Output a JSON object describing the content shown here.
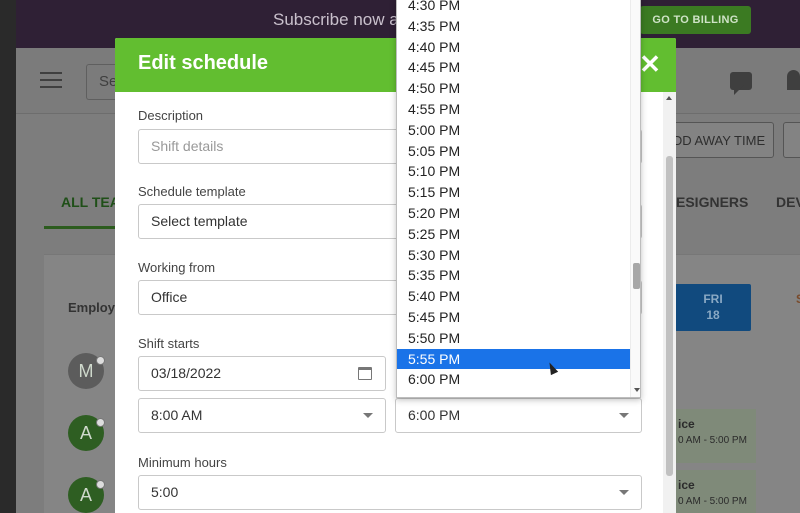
{
  "banner": {
    "subscribe_text": "Subscribe now a",
    "billing_button": "GO TO BILLING"
  },
  "appbar": {
    "search_placeholder": "Se",
    "add_away_button": "DD AWAY TIME"
  },
  "tabs": {
    "all": "ALL TEA",
    "designers": "ESIGNERS",
    "dev": "DEV"
  },
  "schedule": {
    "employees_label": "Employe",
    "fri_day": "FRI",
    "fri_date": "18",
    "sat_mark": "S",
    "avatars": [
      "M",
      "A",
      "A"
    ],
    "shifts": [
      {
        "title": "ice",
        "time": "0 AM - 5:00 PM"
      },
      {
        "title": "ice",
        "time": "0 AM - 5:00 PM"
      }
    ]
  },
  "modal": {
    "title": "Edit schedule",
    "close_icon": "close-icon",
    "description_label": "Description",
    "description_placeholder": "Shift details",
    "template_label": "Schedule template",
    "template_value": "Select template",
    "working_from_label": "Working from",
    "working_from_value": "Office",
    "shift_starts_label": "Shift starts",
    "shift_date": "03/18/2022",
    "start_time": "8:00 AM",
    "end_time": "6:00 PM",
    "min_hours_label": "Minimum hours",
    "min_hours_value": "5:00"
  },
  "time_options": [
    "4:30 PM",
    "4:35 PM",
    "4:40 PM",
    "4:45 PM",
    "4:50 PM",
    "4:55 PM",
    "5:00 PM",
    "5:05 PM",
    "5:10 PM",
    "5:15 PM",
    "5:20 PM",
    "5:25 PM",
    "5:30 PM",
    "5:35 PM",
    "5:40 PM",
    "5:45 PM",
    "5:50 PM",
    "5:55 PM",
    "6:00 PM"
  ],
  "highlighted_option": "5:55 PM",
  "colors": {
    "header_green": "#62be30",
    "highlight_blue": "#1a73e8"
  }
}
